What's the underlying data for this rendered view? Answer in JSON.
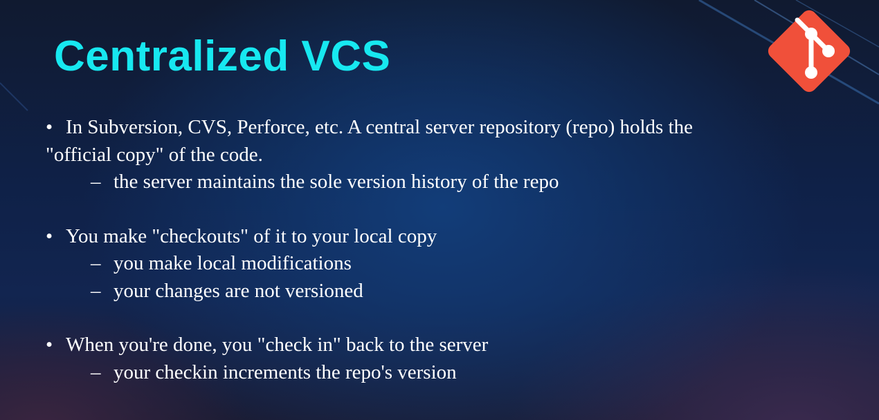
{
  "slide": {
    "title": "Centralized VCS",
    "logo_icon": "git-logo-icon",
    "accent_color": "#17e8f0",
    "logo_color": "#f0503a",
    "bullets": [
      {
        "text": "In Subversion, CVS, Perforce, etc. A central server repository (repo) holds the",
        "text_cont": "\"official copy\" of the code.",
        "subs": [
          "the server maintains the sole version history of the repo"
        ]
      },
      {
        "text": "You make \"checkouts\" of it to your local copy",
        "subs": [
          "you make local modifications",
          "your changes are not versioned"
        ]
      },
      {
        "text": "When you're done, you \"check in\" back to the server",
        "subs": [
          "your checkin increments the repo's version"
        ]
      }
    ],
    "bullet_glyph": "•",
    "dash_glyph": "–"
  }
}
